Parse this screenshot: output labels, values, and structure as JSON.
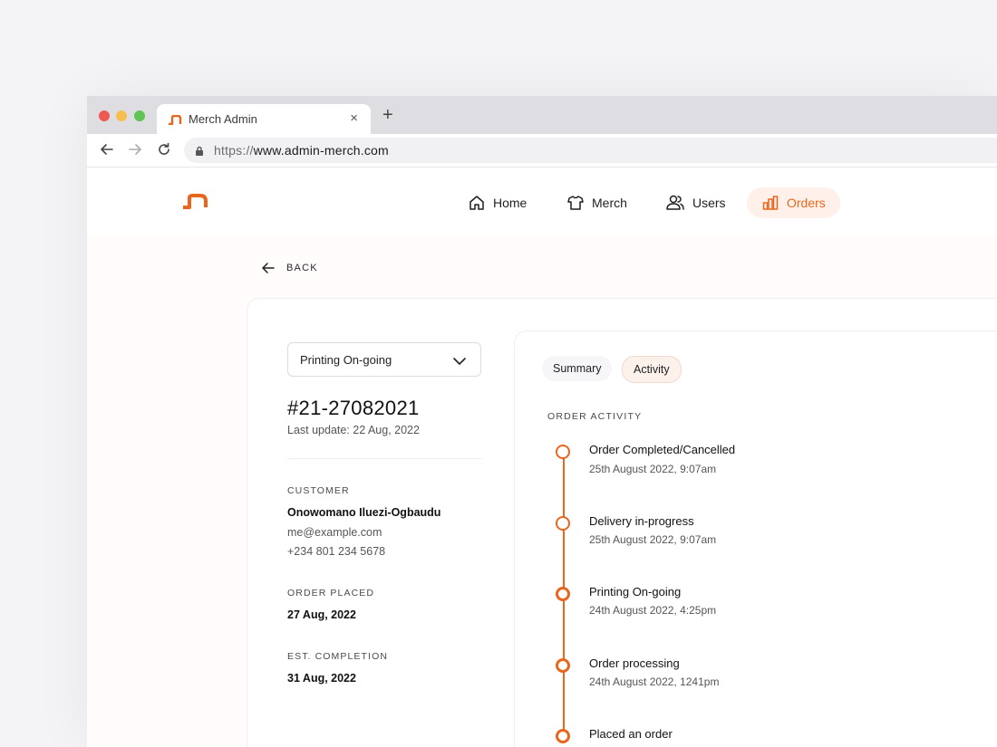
{
  "browser": {
    "tab_title": "Merch Admin",
    "close_symbol": "×",
    "new_tab_symbol": "+",
    "url_scheme": "https://",
    "url_host": "www.admin-merch.com"
  },
  "nav": {
    "items": [
      {
        "label": "Home",
        "icon": "home-icon"
      },
      {
        "label": "Merch",
        "icon": "tshirt-icon"
      },
      {
        "label": "Users",
        "icon": "users-icon"
      },
      {
        "label": "Orders",
        "icon": "bar-chart-icon",
        "active": true
      }
    ]
  },
  "back_label": "BACK",
  "order": {
    "status_value": "Printing On-going",
    "id": "#21-27082021",
    "last_update": "Last update: 22 Aug, 2022",
    "customer_label": "CUSTOMER",
    "customer_name": "Onowomano Iluezi-Ogbaudu",
    "customer_email": "me@example.com",
    "customer_phone": "+234 801 234 5678",
    "placed_label": "ORDER PLACED",
    "placed_date": "27 Aug, 2022",
    "completion_label": "EST. COMPLETION",
    "completion_date": "31 Aug, 2022"
  },
  "tabs": {
    "summary": "Summary",
    "activity": "Activity"
  },
  "activity": {
    "label": "ORDER ACTIVITY",
    "items": [
      {
        "title": "Order Completed/Cancelled",
        "time": "25th August 2022, 9:07am",
        "done": false
      },
      {
        "title": "Delivery in-progress",
        "time": "25th August 2022, 9:07am",
        "done": false
      },
      {
        "title": "Printing On-going",
        "time": "24th August 2022, 4:25pm",
        "done": true
      },
      {
        "title": "Order processing",
        "time": "24th August 2022, 1241pm",
        "done": true
      },
      {
        "title": "Placed an order",
        "time": "",
        "done": true
      }
    ]
  },
  "colors": {
    "accent": "#e8661d",
    "accent_bg": "#fff1ea"
  }
}
